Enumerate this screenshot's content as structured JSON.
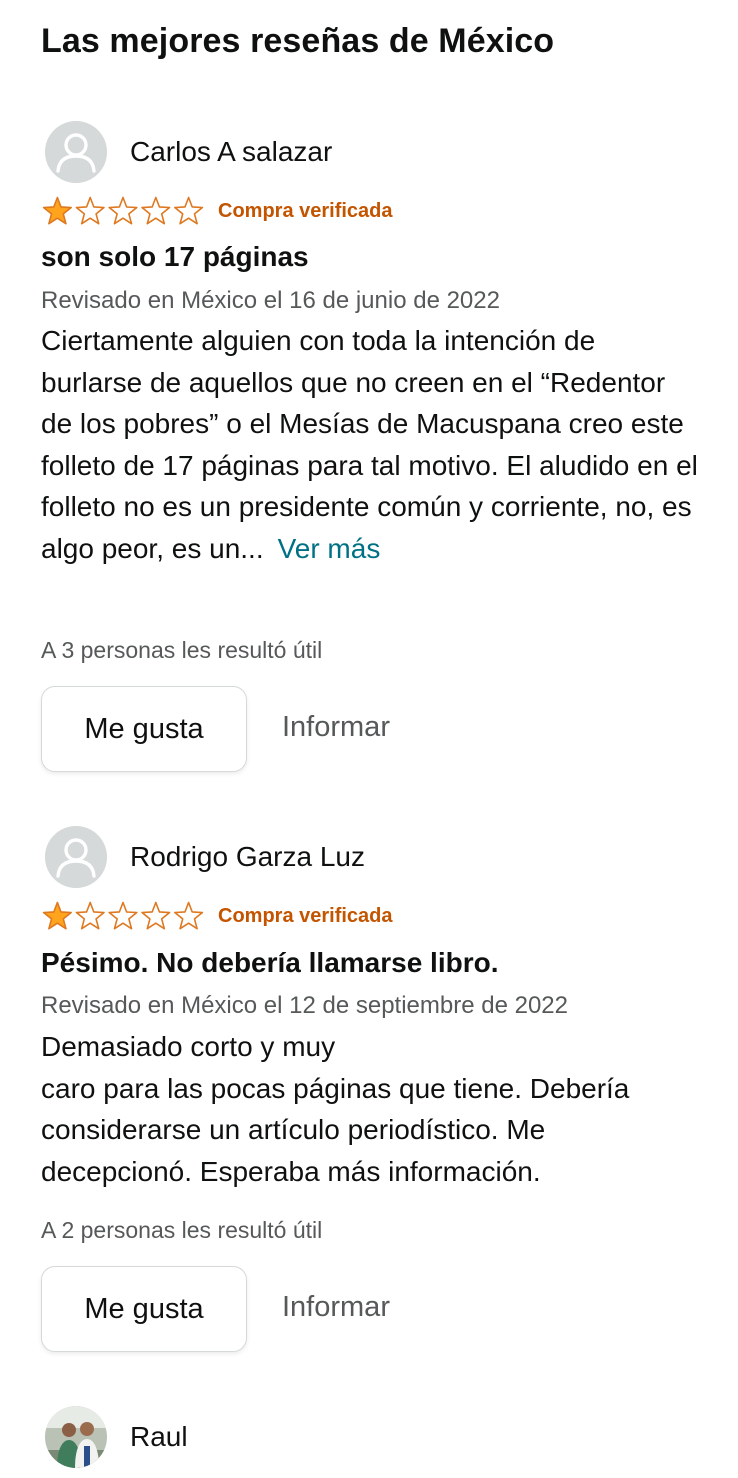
{
  "page": {
    "section_title": "Las mejores reseñas de México"
  },
  "colors": {
    "star_fill": "#ffa41c",
    "star_stroke": "#de7921",
    "verified": "#c45500",
    "link": "#007185",
    "muted": "#565959"
  },
  "reviews": [
    {
      "author": "Carlos A salazar",
      "avatar_icon": "default-user-avatar-icon",
      "rating": 1,
      "max_rating": 5,
      "verified_label": "Compra verificada",
      "title": "son solo 17 páginas",
      "meta": "Revisado en México el 16 de junio de 2022",
      "body": "Ciertamente alguien con toda la intención de burlarse de aquellos que no creen en el “Redentor de los pobres” o el Mesías de Macuspana creo este folleto de 17 páginas para tal motivo. El aludido en el folleto no es un presidente común y corriente, no, es algo peor, es un...",
      "more_label": "Ver más",
      "helpful": "A 3 personas les resultó útil",
      "like_label": "Me gusta",
      "report_label": "Informar"
    },
    {
      "author": "Rodrigo Garza Luz",
      "avatar_icon": "default-user-avatar-icon",
      "rating": 1,
      "max_rating": 5,
      "verified_label": "Compra verificada",
      "title": "Pésimo. No debería llamarse libro.",
      "meta": "Revisado en México el 12 de septiembre de 2022",
      "body_line1": "Demasiado corto y muy",
      "body_line2": "caro para las pocas páginas que tiene. Debería considerarse un artículo periodístico. Me decepcionó. Esperaba más información.",
      "helpful": "A 2 personas les resultó útil",
      "like_label": "Me gusta",
      "report_label": "Informar"
    },
    {
      "author": "Raul",
      "avatar_icon": "user-photo-avatar-icon"
    }
  ]
}
